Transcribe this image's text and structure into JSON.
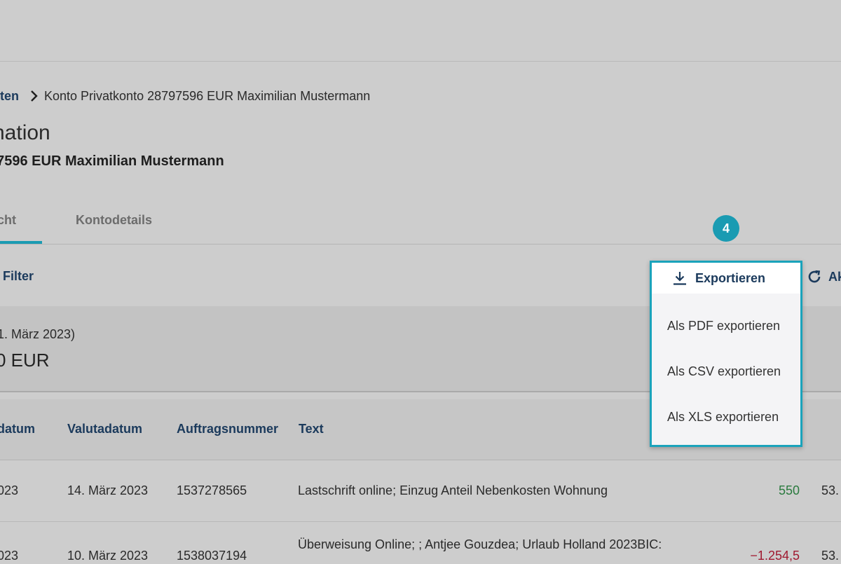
{
  "breadcrumb": {
    "parent_label": "ten",
    "current_label": "Konto Privatkonto 28797596 EUR Maximilian Mustermann"
  },
  "page": {
    "title": "nation",
    "subtitle": "97596 EUR Maximilian Mustermann"
  },
  "tabs": [
    {
      "label": "cht",
      "active": true
    },
    {
      "label": "Kontodetails",
      "active": false
    }
  ],
  "toolbar": {
    "filter_label": "Filter",
    "refresh_label": "Ak",
    "refresh_icon": "refresh-icon"
  },
  "balance": {
    "date_text": "1. März 2023)",
    "amount_text": "0 EUR"
  },
  "table": {
    "columns": [
      "datum",
      "Valutadatum",
      "Auftragsnummer",
      "Text"
    ],
    "rows": [
      {
        "date": "023",
        "value_date": "14. März 2023",
        "order_number": "1537278565",
        "text": "Lastschrift online; Einzug Anteil Nebenkosten Wohnung",
        "amount": "550",
        "balance": "53."
      },
      {
        "date": "023",
        "value_date": "10. März 2023",
        "order_number": "1538037194",
        "text": "Überweisung Online; ; Antjee Gouzdea; Urlaub Holland 2023BIC:",
        "amount": "−1.254,5",
        "balance": "53."
      }
    ]
  },
  "tutorial": {
    "step_number": "4",
    "accent_color": "#1aa3bb"
  },
  "export_menu": {
    "button_label": "Exportieren",
    "icon": "download-icon",
    "items": [
      "Als PDF exportieren",
      "Als CSV exportieren",
      "Als XLS exportieren"
    ]
  },
  "colors": {
    "positive": "#2a7a3e",
    "negative": "#a0182f",
    "link": "#1b3a5c"
  }
}
